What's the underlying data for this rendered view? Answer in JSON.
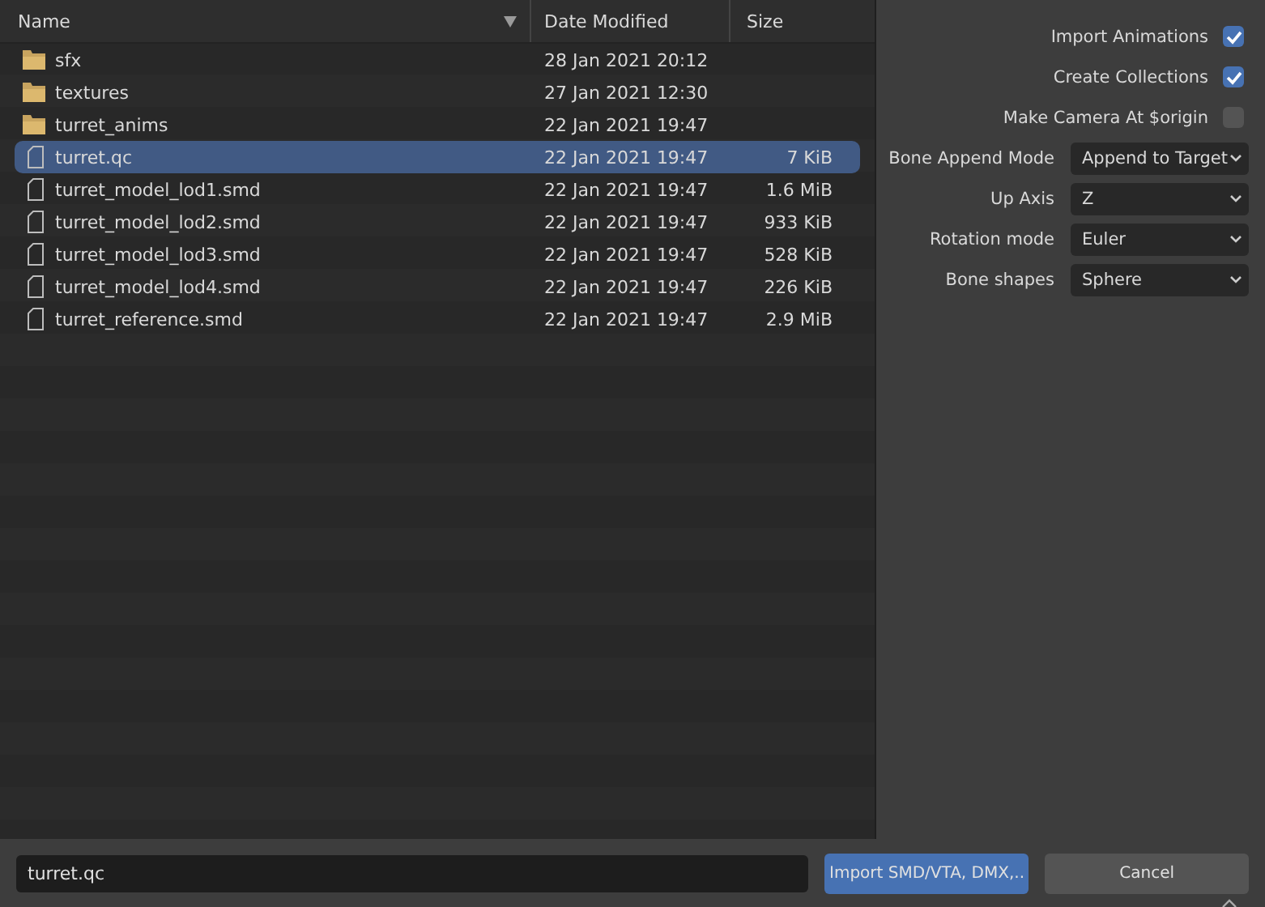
{
  "file_list": {
    "columns": [
      {
        "label": "Name",
        "sorted": true
      },
      {
        "label": "Date Modified",
        "sorted": false
      },
      {
        "label": "Size",
        "sorted": false
      }
    ],
    "rows": [
      {
        "kind": "folder",
        "name": "sfx",
        "date": "28 Jan 2021 20:12",
        "selected": false
      },
      {
        "kind": "folder",
        "name": "textures",
        "date": "27 Jan 2021 12:30",
        "selected": false
      },
      {
        "kind": "folder",
        "name": "turret_anims",
        "date": "22 Jan 2021 19:47",
        "selected": false
      },
      {
        "kind": "file",
        "name": "turret.qc",
        "date": "22 Jan 2021 19:47",
        "size": "7 KiB",
        "selected": true
      },
      {
        "kind": "file",
        "name": "turret_model_lod1.smd",
        "date": "22 Jan 2021 19:47",
        "size": "1.6 MiB",
        "selected": false
      },
      {
        "kind": "file",
        "name": "turret_model_lod2.smd",
        "date": "22 Jan 2021 19:47",
        "size": "933 KiB",
        "selected": false
      },
      {
        "kind": "file",
        "name": "turret_model_lod3.smd",
        "date": "22 Jan 2021 19:47",
        "size": "528 KiB",
        "selected": false
      },
      {
        "kind": "file",
        "name": "turret_model_lod4.smd",
        "date": "22 Jan 2021 19:47",
        "size": "226 KiB",
        "selected": false
      },
      {
        "kind": "file",
        "name": "turret_reference.smd",
        "date": "22 Jan 2021 19:47",
        "size": "2.9 MiB",
        "selected": false
      }
    ]
  },
  "options": [
    {
      "kind": "checkbox",
      "label": "Import Animations",
      "checked": true
    },
    {
      "kind": "checkbox",
      "label": "Create Collections",
      "checked": true
    },
    {
      "kind": "checkbox",
      "label": "Make Camera At $origin",
      "checked": false
    },
    {
      "kind": "dropdown",
      "label": "Bone Append Mode",
      "value": "Append to Target"
    },
    {
      "kind": "dropdown",
      "label": "Up Axis",
      "value": "Z"
    },
    {
      "kind": "dropdown",
      "label": "Rotation mode",
      "value": "Euler"
    },
    {
      "kind": "dropdown",
      "label": "Bone shapes",
      "value": "Sphere"
    }
  ],
  "footer": {
    "filename": "turret.qc",
    "buttons": [
      {
        "label": "Import SMD/VTA, DMX,..",
        "primary": true
      },
      {
        "label": "Cancel",
        "primary": false
      }
    ]
  }
}
